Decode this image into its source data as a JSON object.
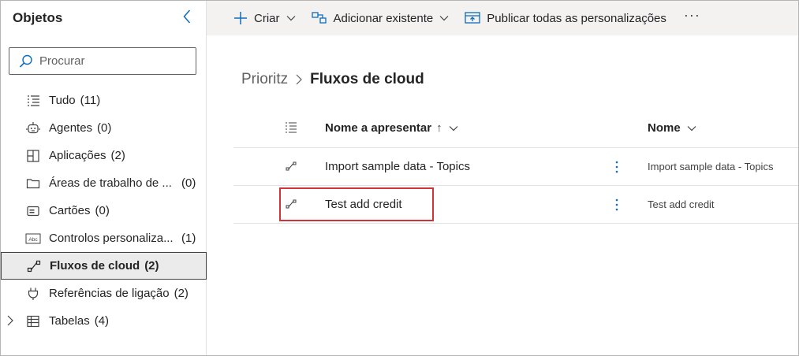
{
  "sidebar": {
    "title": "Objetos",
    "search": {
      "placeholder": "Procurar",
      "value": ""
    },
    "items": [
      {
        "label": "Tudo",
        "count": "(11)",
        "icon": "list-icon"
      },
      {
        "label": "Agentes",
        "count": "(0)",
        "icon": "agent-icon"
      },
      {
        "label": "Aplicações",
        "count": "(2)",
        "icon": "apps-icon"
      },
      {
        "label": "Áreas de trabalho de ...",
        "count": "(0)",
        "icon": "folder-icon"
      },
      {
        "label": "Cartões",
        "count": "(0)",
        "icon": "card-icon"
      },
      {
        "label": "Controlos personaliza...",
        "count": "(1)",
        "icon": "abc-control-icon"
      },
      {
        "label": "Fluxos de cloud",
        "count": "(2)",
        "icon": "flow-icon",
        "selected": true
      },
      {
        "label": "Referências de ligação",
        "count": "(2)",
        "icon": "plug-icon"
      },
      {
        "label": "Tabelas",
        "count": "(4)",
        "icon": "table-icon",
        "expandable": true
      }
    ]
  },
  "toolbar": {
    "create_label": "Criar",
    "add_existing_label": "Adicionar existente",
    "publish_label": "Publicar todas as personalizações",
    "more_label": "···"
  },
  "breadcrumb": {
    "parent": "Prioritz",
    "current": "Fluxos de cloud"
  },
  "table": {
    "columns": {
      "display_name": "Nome a apresentar",
      "sort_arrow": "↑",
      "name": "Nome"
    },
    "rows": [
      {
        "display_name": "Import sample data - Topics",
        "name": "Import sample data - Topics"
      },
      {
        "display_name": "Test add credit",
        "name": "Test add credit",
        "highlighted": true
      }
    ]
  },
  "colors": {
    "accent": "#0f6cbd",
    "highlight": "#d13438",
    "selected_bg": "#ebebeb",
    "toolbar_bg": "#f3f2f1"
  }
}
